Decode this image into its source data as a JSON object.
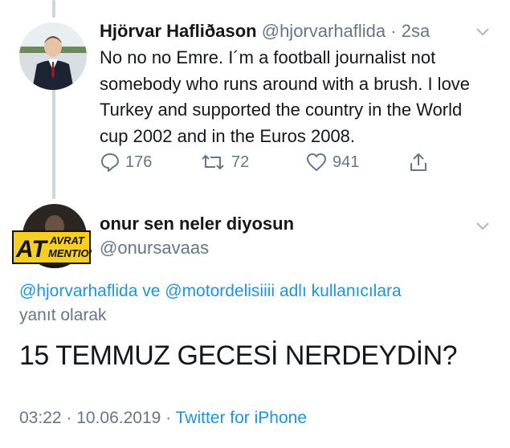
{
  "tweet1": {
    "display_name": "Hjörvar Hafliðason",
    "handle": "@hjorvarhaflida",
    "separator": "·",
    "time": "2sa",
    "text": "No no no Emre. I´m a football journalist not somebody who runs around with a brush. I love Turkey and supported the country in the World cup 2002 and in the Euros 2008.",
    "actions": {
      "reply_count": "176",
      "retweet_count": "72",
      "like_count": "941"
    }
  },
  "tweet2": {
    "display_name": "onur sen neler diyosun",
    "handle": "@onursavaas",
    "avatar_badge_line1": "AVRAT",
    "avatar_badge_line2": "MENTION",
    "avatar_badge_big": "AT",
    "reply_to": {
      "mention1": "@hjorvarhaflida",
      "connector": " ve ",
      "mention2": "@motordelisiiii",
      "suffix": " adlı kullanıcılara",
      "line2": "yanıt olarak"
    },
    "text": "15 TEMMUZ GECESİ NERDEYDİN?",
    "timestamp": "03:22 · 10.06.2019 · ",
    "source": "Twitter for iPhone"
  },
  "colors": {
    "accent": "#1b95e0",
    "muted": "#657786",
    "text": "#14171a",
    "thread": "#ccd6dd"
  }
}
